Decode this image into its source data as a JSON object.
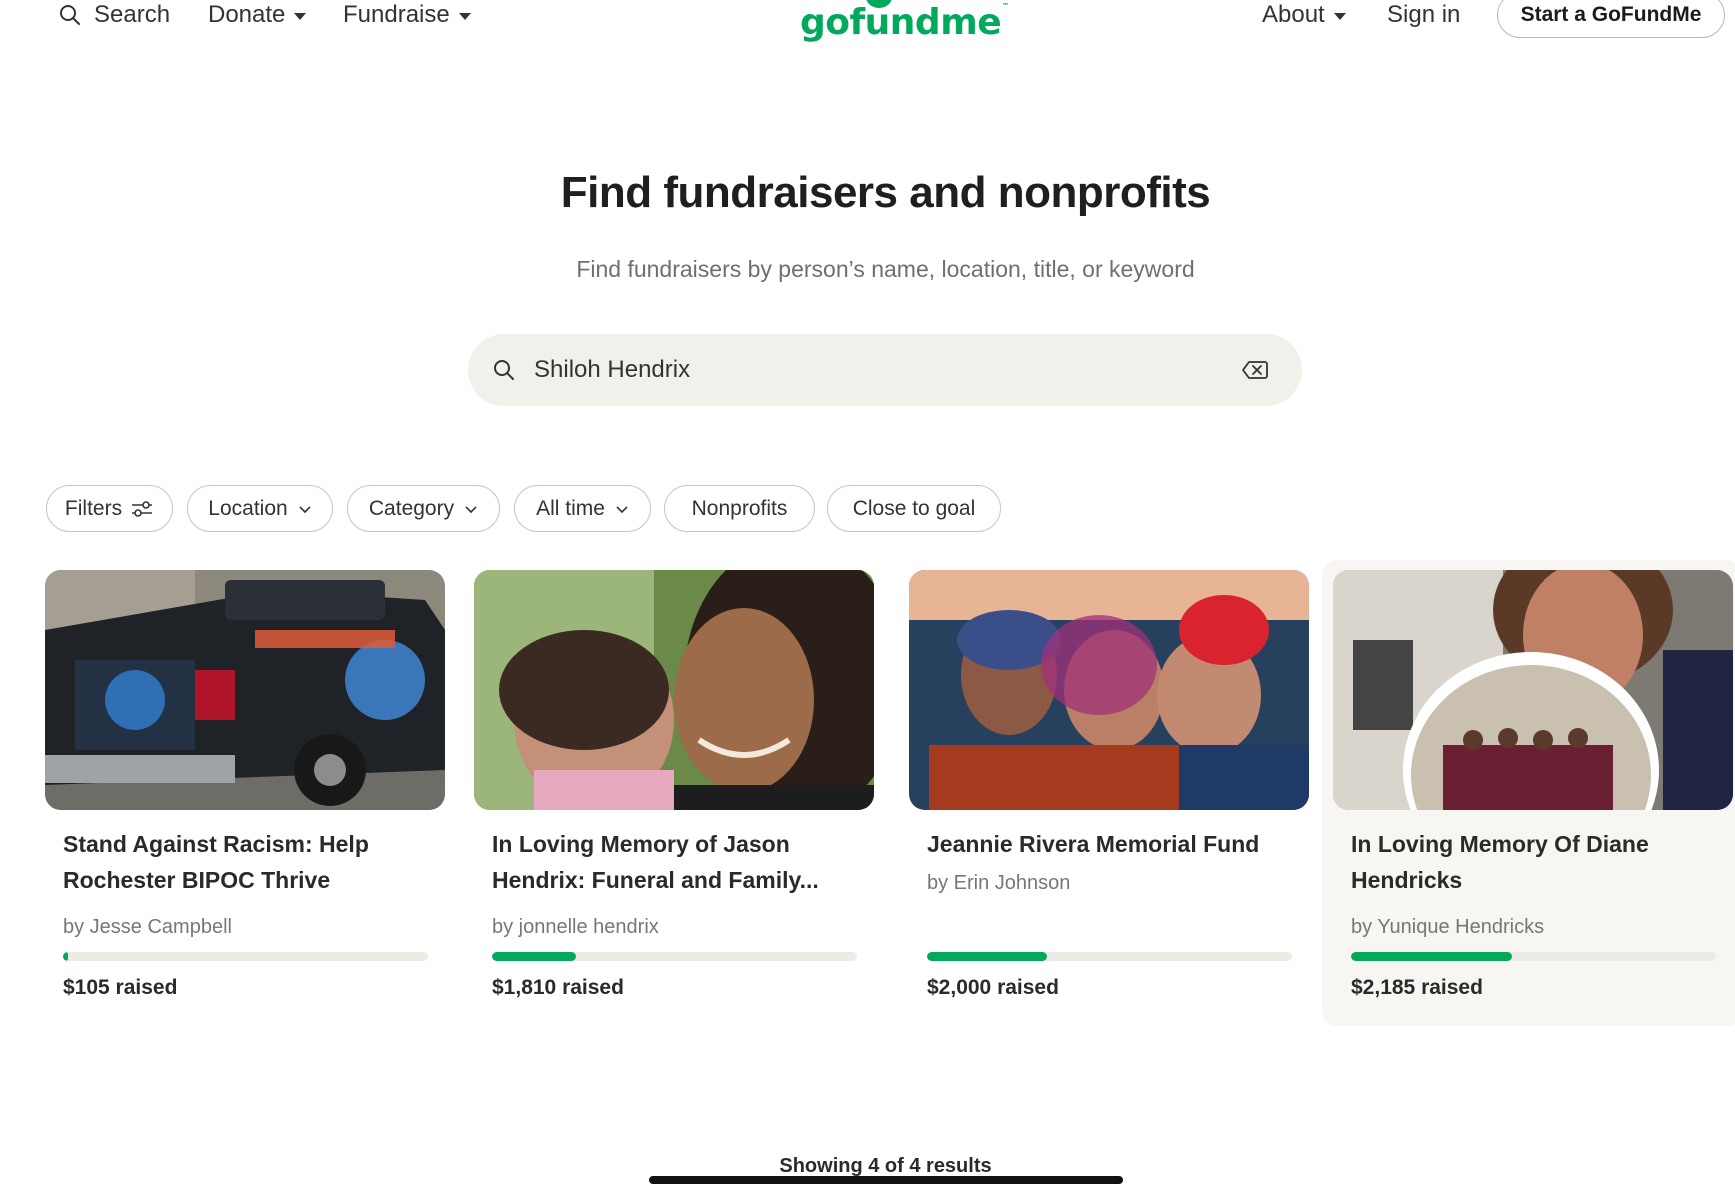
{
  "header": {
    "search_label": "Search",
    "donate_label": "Donate",
    "fundraise_label": "Fundraise",
    "logo_text": "gofundme",
    "logo_tm": "™",
    "about_label": "About",
    "signin_label": "Sign in",
    "start_label": "Start a GoFundMe"
  },
  "hero": {
    "title": "Find fundraisers and nonprofits",
    "subtitle": "Find fundraisers by person’s name, location, title, or keyword"
  },
  "search": {
    "value": "Shiloh Hendrix"
  },
  "filters": {
    "filters_label": "Filters",
    "location_label": "Location",
    "category_label": "Category",
    "time_label": "All time",
    "nonprofits_label": "Nonprofits",
    "close_goal_label": "Close to goal"
  },
  "results": [
    {
      "title_line1": "Stand Against Racism: Help",
      "title_line2": "Rochester BIPOC Thrive",
      "organizer": "by Jesse Campbell",
      "raised": "$105 raised",
      "progress": 0.015,
      "image": "pickup-truck-photo"
    },
    {
      "title_line1": "In Loving Memory of Jason",
      "title_line2": "Hendrix: Funeral and Family...",
      "organizer": "by jonnelle hendrix",
      "raised": "$1,810 raised",
      "progress": 0.23,
      "image": "father-and-child-photo"
    },
    {
      "title_line1": "Jeannie Rivera Memorial Fund",
      "title_line2": "",
      "organizer": "by Erin Johnson",
      "raised": "$2,000 raised",
      "progress": 0.33,
      "image": "three-women-photo"
    },
    {
      "title_line1": "In Loving Memory Of Diane",
      "title_line2": "Hendricks",
      "organizer": "by Yunique Hendricks",
      "raised": "$2,185 raised",
      "progress": 0.44,
      "image": "woman-and-choir-photo"
    }
  ],
  "footer": {
    "results_text": "Showing 4 of 4 results"
  },
  "colors": {
    "brand_green": "#02a95c",
    "search_bg": "#f2f0eb",
    "progress_track": "#ecebe6"
  }
}
